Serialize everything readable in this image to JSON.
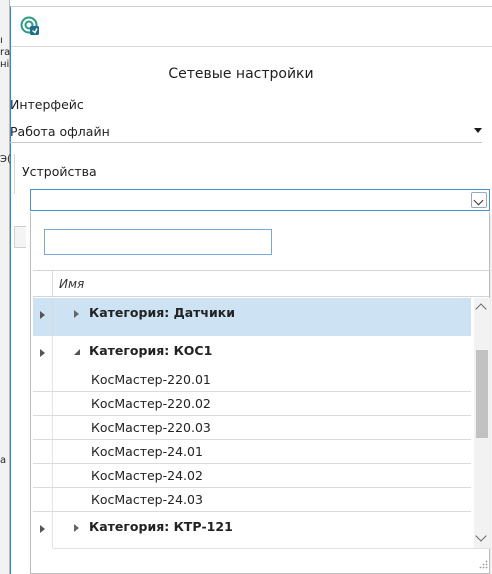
{
  "background_window": {
    "fragments": [
      "ı",
      "ra",
      "ні",
      "Э(",
      "a"
    ]
  },
  "dialog": {
    "title": "Сетевые настройки",
    "interface": {
      "label": "Интерфейс",
      "value": "Работа офлайн"
    },
    "devices": {
      "label": "Устройства",
      "value": ""
    }
  },
  "dropdown": {
    "filter": {
      "value": "",
      "placeholder": ""
    },
    "grid": {
      "column_header": "Имя",
      "rows": [
        {
          "type": "group",
          "label": "Категория: Датчики",
          "expanded": false,
          "selected": true
        },
        {
          "type": "group",
          "label": "Категория: КОС1",
          "expanded": true,
          "selected": false
        },
        {
          "type": "item",
          "label": "КосМастер-220.01"
        },
        {
          "type": "item",
          "label": "КосМастер-220.02"
        },
        {
          "type": "item",
          "label": "КосМастер-220.03"
        },
        {
          "type": "item",
          "label": "КосМастер-24.01"
        },
        {
          "type": "item",
          "label": "КосМастер-24.02"
        },
        {
          "type": "item",
          "label": "КосМастер-24.03"
        },
        {
          "type": "group",
          "label": "Категория: КТР-121",
          "expanded": false,
          "selected": false
        }
      ]
    },
    "scrollbar": {
      "position": 0.25
    }
  },
  "colors": {
    "selection": "#cde3f3",
    "focus_border": "#4a90d9",
    "window_accent": "#2e8bd1"
  },
  "icons": {
    "app": "network-settings-icon",
    "scroll_up": "chevron-up-icon",
    "scroll_down": "chevron-down-icon",
    "combo_arrow": "dropdown-arrow-icon"
  }
}
